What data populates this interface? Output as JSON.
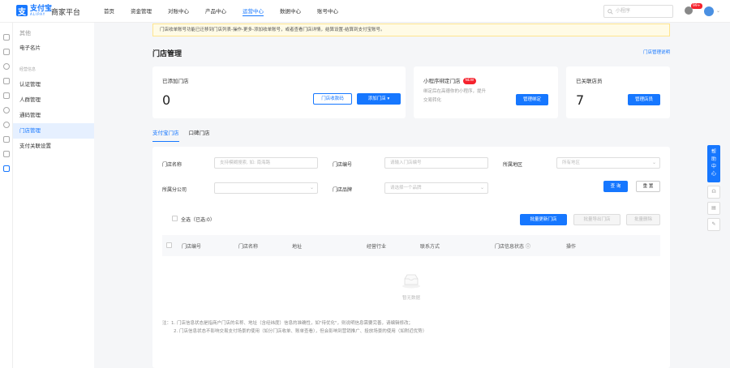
{
  "header": {
    "logo_mark": "支",
    "logo_cn": "支付宝",
    "logo_en": "ALIPAY",
    "platform": "商家平台",
    "nav": [
      "首页",
      "资金管理",
      "对账中心",
      "产品中心",
      "运营中心",
      "数据中心",
      "账号中心"
    ],
    "active_nav": "运营中心",
    "search_placeholder": "小程序",
    "badge": "99+"
  },
  "sidebar": {
    "top_title": "其他",
    "top_items": [
      "电子名片"
    ],
    "section": "经营信息",
    "items": [
      "认证管理",
      "人群管理",
      "通码管理",
      "门店管理",
      "支付关联设置"
    ],
    "active": "门店管理"
  },
  "notice": "门店收单账号功能已迁移到门店列表-操作-更多-添加收单账号，或者查看门店详情，结算设置-结算到支付宝账号。",
  "page": {
    "title": "门店管理",
    "help_link": "门店管理说明"
  },
  "cards": {
    "stores": {
      "label": "已添加门店",
      "count": "0",
      "btn_qr": "门店收款码",
      "btn_add": "添加门店"
    },
    "miniprogram": {
      "label": "小程序绑定门店",
      "badge": "NEW",
      "desc": "绑定后在高德你的小程序，提升交易转化",
      "btn": "管理绑定"
    },
    "members": {
      "label": "已关联店员",
      "count": "7",
      "btn": "管理店员"
    }
  },
  "tabs": [
    "支付宝门店",
    "口碑门店"
  ],
  "active_tab": "支付宝门店",
  "filters": {
    "name_label": "门店名称",
    "name_placeholder": "支持模糊搜索, 如: 南海路",
    "code_label": "门店编号",
    "code_placeholder": "请输入门店编号",
    "region_label": "所属地区",
    "region_placeholder": "所有地区",
    "branch_label": "所属分公司",
    "branch_placeholder": "",
    "brand_label": "门店品牌",
    "brand_placeholder": "请选择一个品牌",
    "query": "查 询",
    "reset": "重 置"
  },
  "actions": {
    "select_all": "全选（已选:0）",
    "batch_update": "批量更新门店",
    "batch_export": "批量导出门店",
    "batch_delete": "批量删除"
  },
  "table": {
    "columns": [
      "门店编号",
      "门店名称",
      "地址",
      "经营行业",
      "联系方式",
      "门店信息状态",
      "操作"
    ],
    "empty_text": "暂无数据"
  },
  "notes": [
    "注：1. 门店信息状态是指商户门店的名称、地址（含经纬度）信息的准确性，如\"待优化\"，则说明信息需要完善，请编辑修改；",
    "2. 门店信息状态不影响交易支付场景的使用（如分门店收单、账单查看），但会影响到营销推广、投放场景的使用（如附近优势）"
  ],
  "right_tools": {
    "help": [
      "帮",
      "助",
      "中",
      "心"
    ]
  }
}
